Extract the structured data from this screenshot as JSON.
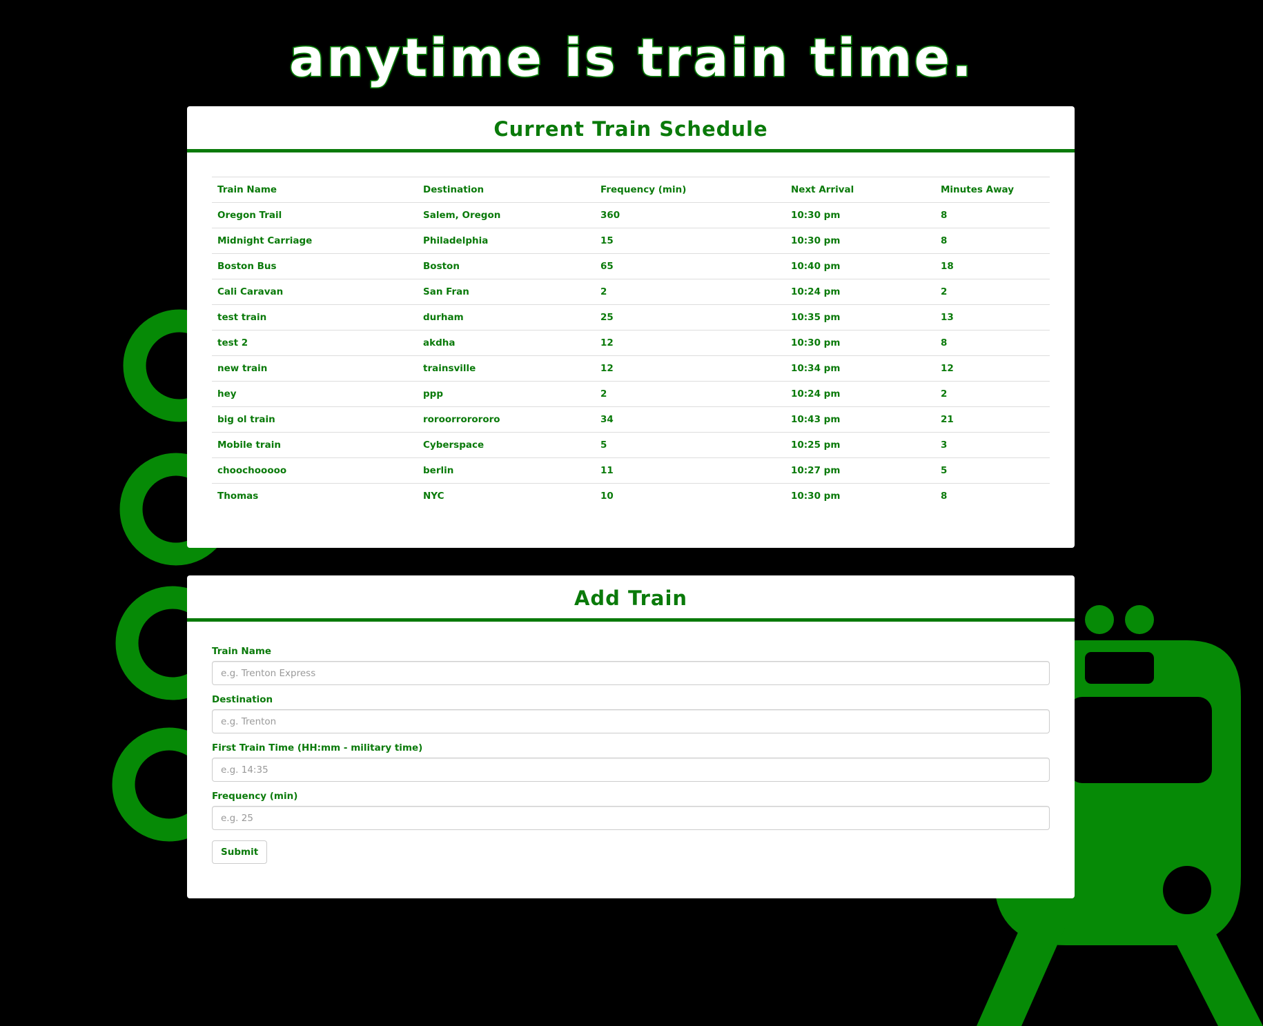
{
  "page": {
    "headline": "anytime is train time."
  },
  "colors": {
    "accent": "#0a7a0a",
    "art_green": "#068a06",
    "background": "#000000",
    "panel": "#ffffff"
  },
  "decoration": {
    "icons": [
      "rail-ring-icon",
      "train-front-icon"
    ]
  },
  "schedule": {
    "title": "Current Train Schedule",
    "columns": [
      "Train Name",
      "Destination",
      "Frequency (min)",
      "Next Arrival",
      "Minutes Away"
    ],
    "rows": [
      [
        "Oregon Trail",
        "Salem, Oregon",
        "360",
        "10:30 pm",
        "8"
      ],
      [
        "Midnight Carriage",
        "Philadelphia",
        "15",
        "10:30 pm",
        "8"
      ],
      [
        "Boston Bus",
        "Boston",
        "65",
        "10:40 pm",
        "18"
      ],
      [
        "Cali Caravan",
        "San Fran",
        "2",
        "10:24 pm",
        "2"
      ],
      [
        "test train",
        "durham",
        "25",
        "10:35 pm",
        "13"
      ],
      [
        "test 2",
        "akdha",
        "12",
        "10:30 pm",
        "8"
      ],
      [
        "new train",
        "trainsville",
        "12",
        "10:34 pm",
        "12"
      ],
      [
        "hey",
        "ppp",
        "2",
        "10:24 pm",
        "2"
      ],
      [
        "big ol train",
        "roroorrorororo",
        "34",
        "10:43 pm",
        "21"
      ],
      [
        "Mobile train",
        "Cyberspace",
        "5",
        "10:25 pm",
        "3"
      ],
      [
        "choochooooo",
        "berlin",
        "11",
        "10:27 pm",
        "5"
      ],
      [
        "Thomas",
        "NYC",
        "10",
        "10:30 pm",
        "8"
      ]
    ]
  },
  "add_train": {
    "title": "Add Train",
    "fields": [
      {
        "label": "Train Name",
        "placeholder": "e.g. Trenton Express",
        "value": ""
      },
      {
        "label": "Destination",
        "placeholder": "e.g. Trenton",
        "value": ""
      },
      {
        "label": "First Train Time (HH:mm - military time)",
        "placeholder": "e.g. 14:35",
        "value": ""
      },
      {
        "label": "Frequency (min)",
        "placeholder": "e.g. 25",
        "value": ""
      }
    ],
    "submit_label": "Submit"
  }
}
